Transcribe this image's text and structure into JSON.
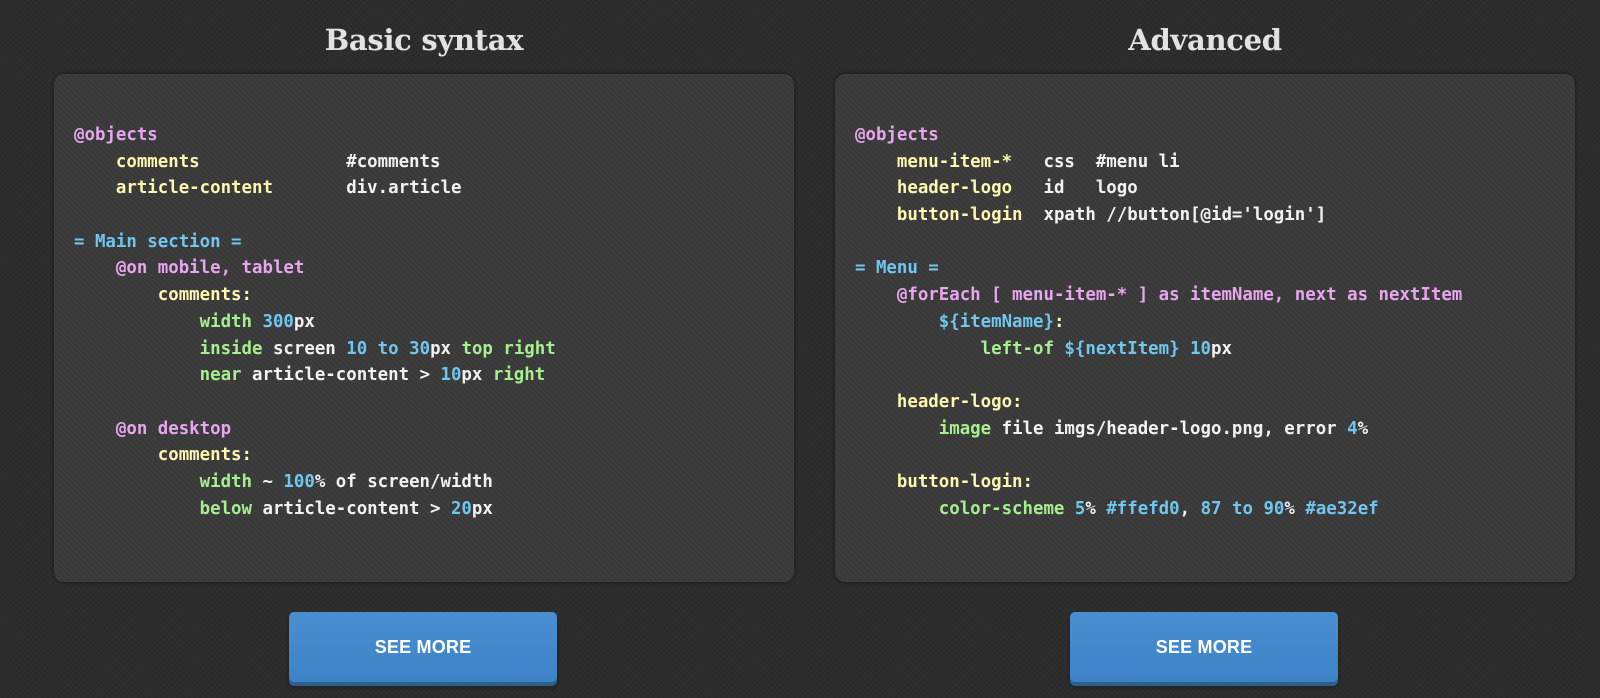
{
  "columns": [
    {
      "title": "Basic syntax",
      "button_label": "SEE MORE",
      "code_lines": [
        [
          {
            "t": "@objects",
            "c": "directive"
          }
        ],
        [
          {
            "t": "    "
          },
          {
            "t": "comments",
            "c": "object"
          },
          {
            "t": "              #comments",
            "c": "plain"
          }
        ],
        [
          {
            "t": "    "
          },
          {
            "t": "article-content",
            "c": "object"
          },
          {
            "t": "       div.article",
            "c": "plain"
          }
        ],
        [],
        [
          {
            "t": "= Main section =",
            "c": "section"
          }
        ],
        [
          {
            "t": "    "
          },
          {
            "t": "@on mobile, tablet",
            "c": "directive"
          }
        ],
        [
          {
            "t": "        "
          },
          {
            "t": "comments:",
            "c": "object"
          }
        ],
        [
          {
            "t": "            "
          },
          {
            "t": "width",
            "c": "rule"
          },
          {
            "t": " "
          },
          {
            "t": "300",
            "c": "number"
          },
          {
            "t": "px",
            "c": "plain"
          }
        ],
        [
          {
            "t": "            "
          },
          {
            "t": "inside",
            "c": "rule"
          },
          {
            "t": " screen ",
            "c": "plain"
          },
          {
            "t": "10",
            "c": "number"
          },
          {
            "t": " "
          },
          {
            "t": "to",
            "c": "number"
          },
          {
            "t": " "
          },
          {
            "t": "30",
            "c": "number"
          },
          {
            "t": "px ",
            "c": "plain"
          },
          {
            "t": "top right",
            "c": "rule"
          }
        ],
        [
          {
            "t": "            "
          },
          {
            "t": "near",
            "c": "rule"
          },
          {
            "t": " article-content > ",
            "c": "plain"
          },
          {
            "t": "10",
            "c": "number"
          },
          {
            "t": "px ",
            "c": "plain"
          },
          {
            "t": "right",
            "c": "rule"
          }
        ],
        [],
        [
          {
            "t": "    "
          },
          {
            "t": "@on desktop",
            "c": "directive"
          }
        ],
        [
          {
            "t": "        "
          },
          {
            "t": "comments:",
            "c": "object"
          }
        ],
        [
          {
            "t": "            "
          },
          {
            "t": "width",
            "c": "rule"
          },
          {
            "t": " ~ ",
            "c": "plain"
          },
          {
            "t": "100",
            "c": "number"
          },
          {
            "t": "% of screen/width",
            "c": "plain"
          }
        ],
        [
          {
            "t": "            "
          },
          {
            "t": "below",
            "c": "rule"
          },
          {
            "t": " article-content > ",
            "c": "plain"
          },
          {
            "t": "20",
            "c": "number"
          },
          {
            "t": "px",
            "c": "plain"
          }
        ]
      ]
    },
    {
      "title": "Advanced",
      "button_label": "SEE MORE",
      "code_lines": [
        [
          {
            "t": "@objects",
            "c": "directive"
          }
        ],
        [
          {
            "t": "    "
          },
          {
            "t": "menu-item-*",
            "c": "object"
          },
          {
            "t": "   css  #menu li",
            "c": "plain"
          }
        ],
        [
          {
            "t": "    "
          },
          {
            "t": "header-logo",
            "c": "object"
          },
          {
            "t": "   id   logo",
            "c": "plain"
          }
        ],
        [
          {
            "t": "    "
          },
          {
            "t": "button-login",
            "c": "object"
          },
          {
            "t": "  xpath //button[@id='login']",
            "c": "plain"
          }
        ],
        [],
        [
          {
            "t": "= Menu =",
            "c": "section"
          }
        ],
        [
          {
            "t": "    "
          },
          {
            "t": "@forEach [ menu-item-* ] as itemName, next as nextItem",
            "c": "directive"
          }
        ],
        [
          {
            "t": "        "
          },
          {
            "t": "${itemName}",
            "c": "section"
          },
          {
            "t": ":",
            "c": "object"
          }
        ],
        [
          {
            "t": "            "
          },
          {
            "t": "left-of",
            "c": "rule"
          },
          {
            "t": " "
          },
          {
            "t": "${nextItem}",
            "c": "section"
          },
          {
            "t": " "
          },
          {
            "t": "10",
            "c": "number"
          },
          {
            "t": "px",
            "c": "plain"
          }
        ],
        [],
        [
          {
            "t": "    "
          },
          {
            "t": "header-logo:",
            "c": "object"
          }
        ],
        [
          {
            "t": "        "
          },
          {
            "t": "image",
            "c": "rule"
          },
          {
            "t": " file imgs/header-logo.png, error ",
            "c": "plain"
          },
          {
            "t": "4",
            "c": "number"
          },
          {
            "t": "%",
            "c": "plain"
          }
        ],
        [],
        [
          {
            "t": "    "
          },
          {
            "t": "button-login:",
            "c": "object"
          }
        ],
        [
          {
            "t": "        "
          },
          {
            "t": "color-scheme",
            "c": "rule"
          },
          {
            "t": " "
          },
          {
            "t": "5",
            "c": "number"
          },
          {
            "t": "% ",
            "c": "plain"
          },
          {
            "t": "#ffefd0",
            "c": "section"
          },
          {
            "t": ", ",
            "c": "plain"
          },
          {
            "t": "87",
            "c": "number"
          },
          {
            "t": " "
          },
          {
            "t": "to",
            "c": "number"
          },
          {
            "t": " "
          },
          {
            "t": "90",
            "c": "number"
          },
          {
            "t": "% ",
            "c": "plain"
          },
          {
            "t": "#ae32ef",
            "c": "section"
          }
        ]
      ]
    }
  ],
  "colors": {
    "background": "#2b2b2b",
    "card": "#3a3a3a",
    "title": "#e2e2e2",
    "directive": "#e8a6ee",
    "object": "#fdf7b0",
    "section": "#6fc7f0",
    "rule": "#a6ef8e",
    "number": "#6fc7f0",
    "plain": "#f2f2f2",
    "button": "#3f86cb",
    "button_text": "#ffffff"
  }
}
